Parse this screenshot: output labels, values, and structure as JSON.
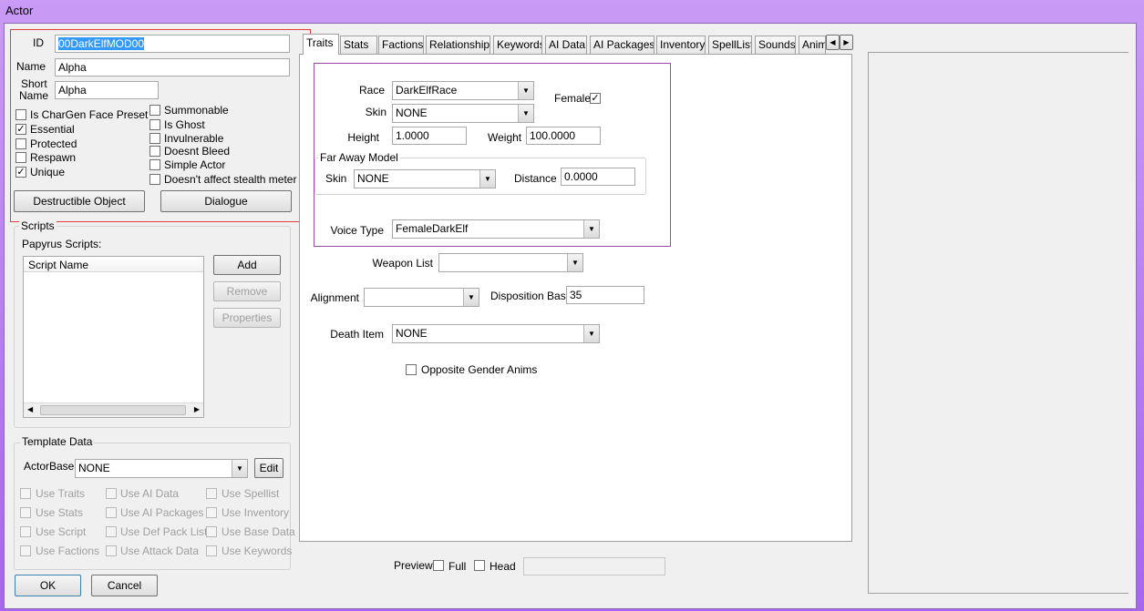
{
  "window": {
    "title": "Actor"
  },
  "basic": {
    "id_label": "ID",
    "id_value": "00DarkElfMOD00",
    "name_label": "Name",
    "name_value": "Alpha",
    "short_name_label_1": "Short",
    "short_name_label_2": "Name",
    "short_name_value": "Alpha"
  },
  "flags_left": [
    {
      "label": "Is CharGen Face Preset",
      "checked": false
    },
    {
      "label": "Essential",
      "checked": true
    },
    {
      "label": "Protected",
      "checked": false
    },
    {
      "label": "Respawn",
      "checked": false
    },
    {
      "label": "Unique",
      "checked": true
    }
  ],
  "flags_right": [
    {
      "label": "Summonable",
      "checked": false
    },
    {
      "label": "Is Ghost",
      "checked": false
    },
    {
      "label": "Invulnerable",
      "checked": false
    },
    {
      "label": "Doesnt Bleed",
      "checked": false
    },
    {
      "label": "Simple Actor",
      "checked": false
    },
    {
      "label": "Doesn't affect stealth meter",
      "checked": false
    }
  ],
  "buttons": {
    "destructible": "Destructible Object",
    "dialogue": "Dialogue",
    "ok": "OK",
    "cancel": "Cancel"
  },
  "scripts": {
    "group_title": "Scripts",
    "papyrus_label": "Papyrus Scripts:",
    "column_header": "Script Name",
    "add": "Add",
    "remove": "Remove",
    "properties": "Properties"
  },
  "template": {
    "group_title": "Template Data",
    "actorbase_label": "ActorBase",
    "actorbase_value": "NONE",
    "edit": "Edit",
    "options": [
      "Use Traits",
      "Use AI Data",
      "Use Spellist",
      "Use Stats",
      "Use AI Packages",
      "Use Inventory",
      "Use Script",
      "Use Def Pack List",
      "Use Base Data",
      "Use Factions",
      "Use Attack Data",
      "Use Keywords"
    ]
  },
  "tabs": [
    "Traits",
    "Stats",
    "Factions",
    "Relationships",
    "Keywords",
    "AI Data",
    "AI Packages",
    "Inventory",
    "SpellList",
    "Sounds",
    "Anim"
  ],
  "traits": {
    "race_label": "Race",
    "race_value": "DarkElfRace",
    "female_label": "Female",
    "female_checked": true,
    "skin_label": "Skin",
    "skin_value": "NONE",
    "height_label": "Height",
    "height_value": "1.0000",
    "weight_label": "Weight",
    "weight_value": "100.0000",
    "far_away_title": "Far Away Model",
    "far_skin_label": "Skin",
    "far_skin_value": "NONE",
    "distance_label": "Distance",
    "distance_value": "0.0000",
    "voice_label": "Voice Type",
    "voice_value": "FemaleDarkElf",
    "weapon_list_label": "Weapon List",
    "weapon_list_value": "",
    "alignment_label": "Alignment",
    "alignment_value": "",
    "disposition_label": "Disposition Base",
    "disposition_value": "35",
    "death_item_label": "Death Item",
    "death_item_value": "NONE",
    "opposite_gender_label": "Opposite Gender Anims"
  },
  "preview": {
    "label": "Preview",
    "full_label": "Full",
    "head_label": "Head"
  },
  "colors": {
    "titlebar": "#b57cf0",
    "highlight": "#3399ff",
    "red_box": "#e0403b",
    "purple_box": "#a04aa8"
  }
}
